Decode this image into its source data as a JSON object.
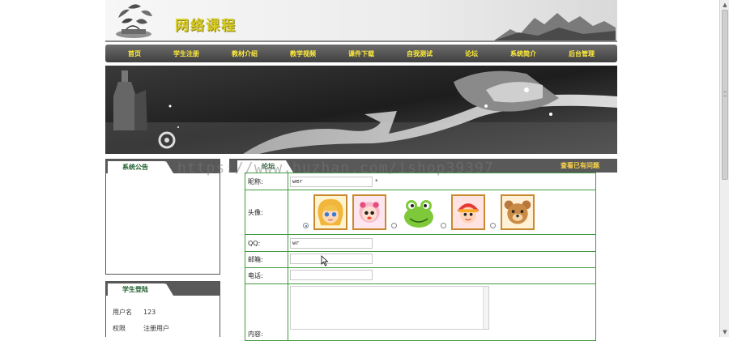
{
  "site": {
    "title": "网络课程"
  },
  "nav": {
    "items": [
      "首页",
      "学生注册",
      "教材介绍",
      "教学视频",
      "课件下载",
      "自我测试",
      "论坛",
      "系统简介",
      "后台管理"
    ]
  },
  "sidebar": {
    "notice_title": "系统公告",
    "login_title": "学生登陆",
    "login_rows": [
      {
        "key": "用户名",
        "value": "123"
      },
      {
        "key": "权限",
        "value": "注册用户"
      }
    ]
  },
  "forum": {
    "tab_label": "论坛",
    "view_link": "查看已有问题",
    "fields": {
      "nickname_label": "昵称:",
      "nickname_value": "wer",
      "nickname_suffix": "*",
      "avatar_label": "头像:",
      "qq_label": "QQ:",
      "qq_value": "wr",
      "email_label": "邮箱:",
      "email_value": "",
      "phone_label": "电话:",
      "phone_value": "",
      "content_label": "内容:"
    },
    "avatars": [
      "girl-blonde-avatar",
      "baby-pink-avatar",
      "frog-avatar",
      "girl-red-hat-avatar",
      "bear-avatar"
    ],
    "selected_avatar_index": 0
  },
  "watermark": "https://www.huzhan.com/ishop39397",
  "colors": {
    "nav_text": "#ffeb3b",
    "title": "#d8cb25",
    "form_border": "#3f9a3f",
    "tab_text": "#1f5e2f",
    "link": "#ffd84a"
  }
}
